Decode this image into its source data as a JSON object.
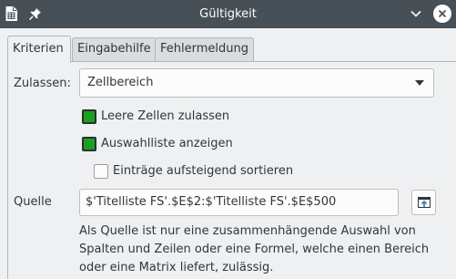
{
  "window": {
    "title": "Gültigkeit",
    "icons": {
      "app": "spreadsheet-icon",
      "pin": "pin-icon",
      "minimize": "chevron-down-icon",
      "close": "close-icon"
    }
  },
  "tabs": [
    {
      "label": "Kriterien",
      "active": true
    },
    {
      "label": "Eingabehilfe",
      "active": false
    },
    {
      "label": "Fehlermeldung",
      "active": false
    }
  ],
  "criteria": {
    "allow_label": "Zulassen:",
    "allow_value": "Zellbereich",
    "checkboxes": [
      {
        "label": "Leere Zellen zulassen",
        "checked": true
      },
      {
        "label": "Auswahlliste anzeigen",
        "checked": true
      },
      {
        "label": "Einträge aufsteigend sortieren",
        "checked": false
      }
    ],
    "source_label": "Quelle",
    "source_value": "$'Titelliste FS'.$E$2:$'Titelliste FS'.$E$500",
    "hint_lines": [
      "Als Quelle ist nur eine zusammenhängende Auswahl von",
      "Spalten und Zeilen oder eine Formel, welche einen Bereich",
      "oder eine Matrix liefert, zulässig."
    ]
  },
  "colors": {
    "titlebar": "#475057",
    "checkbox_checked": "#1aa11e",
    "shrink_icon": "#2980b9"
  }
}
